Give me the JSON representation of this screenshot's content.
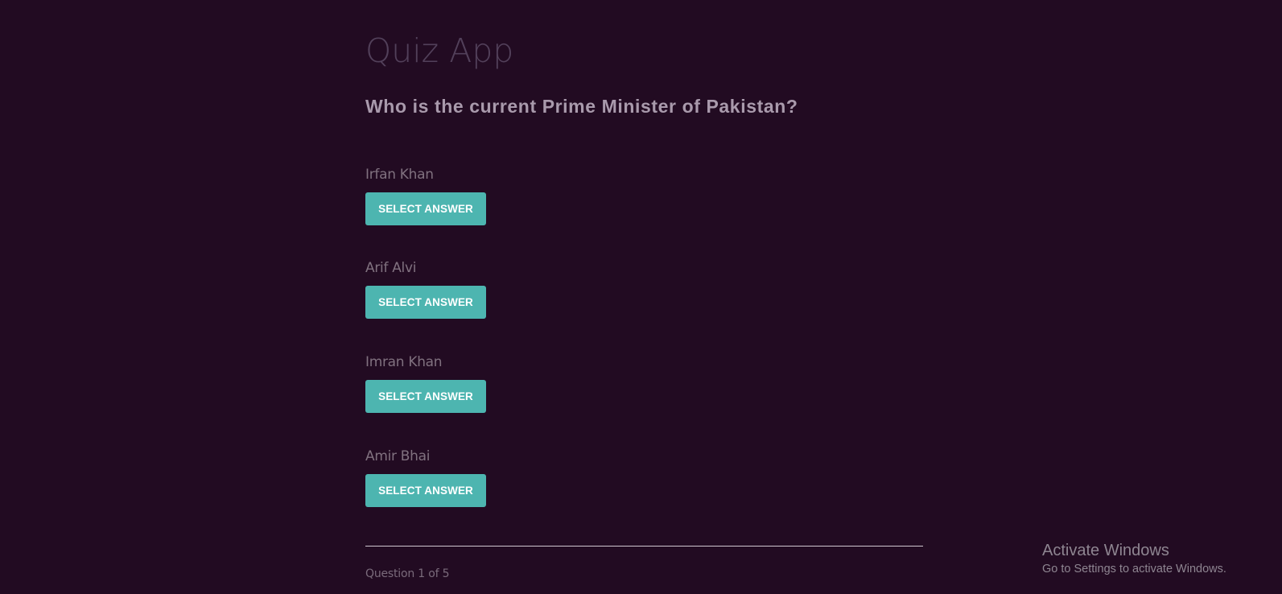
{
  "app": {
    "title": "Quiz App"
  },
  "quiz": {
    "question": "Who is the current Prime Minister of Pakistan?",
    "answers": [
      {
        "text": "Irfan Khan",
        "button_label": "SELECT ANSWER"
      },
      {
        "text": "Arif Alvi",
        "button_label": "SELECT ANSWER"
      },
      {
        "text": "Imran Khan",
        "button_label": "SELECT ANSWER"
      },
      {
        "text": "Amir Bhai",
        "button_label": "SELECT ANSWER"
      }
    ],
    "progress": "Question 1 of 5"
  },
  "os_watermark": {
    "title": "Activate Windows",
    "subtitle": "Go to Settings to activate Windows."
  },
  "colors": {
    "background": "#220b22",
    "accent": "#4db5b0",
    "button_text": "#ffffff"
  }
}
